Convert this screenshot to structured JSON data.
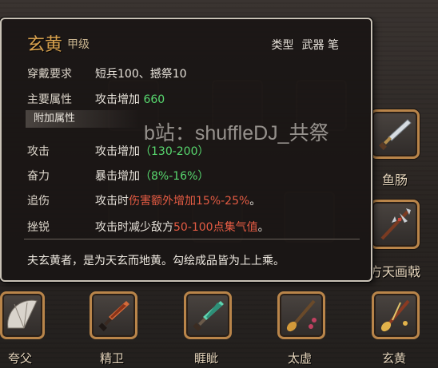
{
  "item": {
    "name": "玄黄",
    "grade": "甲级",
    "type_label": "类型",
    "type_value": "武器 笔",
    "requirement_label": "穿戴要求",
    "requirement_value": "短兵100、撼祭10",
    "main_attr_label": "主要属性",
    "main_attr_text": "攻击增加",
    "main_attr_value": "660",
    "extra_header": "附加属性",
    "attributes": [
      {
        "label": "攻击",
        "text": "攻击增加",
        "highlight": "（130-200）",
        "suffix": ""
      },
      {
        "label": "奋力",
        "text": "暴击增加",
        "highlight": "（8%-16%）",
        "suffix": ""
      },
      {
        "label": "追伤",
        "text": "攻击时",
        "highlight": "伤害额外增加15%-25%",
        "suffix": "。"
      },
      {
        "label": "挫锐",
        "text": "攻击时减少敌方",
        "highlight": "50-100点集气值",
        "suffix": "。"
      }
    ],
    "description": "夫玄黄者，是为天玄而地黄。勾绘成品皆为上上乘。"
  },
  "watermark": "b站：shuffleDJ_共祭",
  "side_weapons": [
    {
      "name": "鱼肠",
      "icon": "dagger-icon"
    },
    {
      "name": "方天画戟",
      "icon": "halberd-icon"
    }
  ],
  "bottom_weapons": [
    {
      "name": "夸父",
      "icon": "fan-icon"
    },
    {
      "name": "精卫",
      "icon": "dagger-dark-icon"
    },
    {
      "name": "睚眦",
      "icon": "jade-dagger-icon"
    },
    {
      "name": "太虚",
      "icon": "brush-icon"
    },
    {
      "name": "玄黄",
      "icon": "brush-gold-icon"
    }
  ],
  "colors": {
    "accent_gold": "#d9a24f",
    "value_green": "#58d86f",
    "value_red": "#e45b43",
    "slot_border": "#b9854a"
  }
}
